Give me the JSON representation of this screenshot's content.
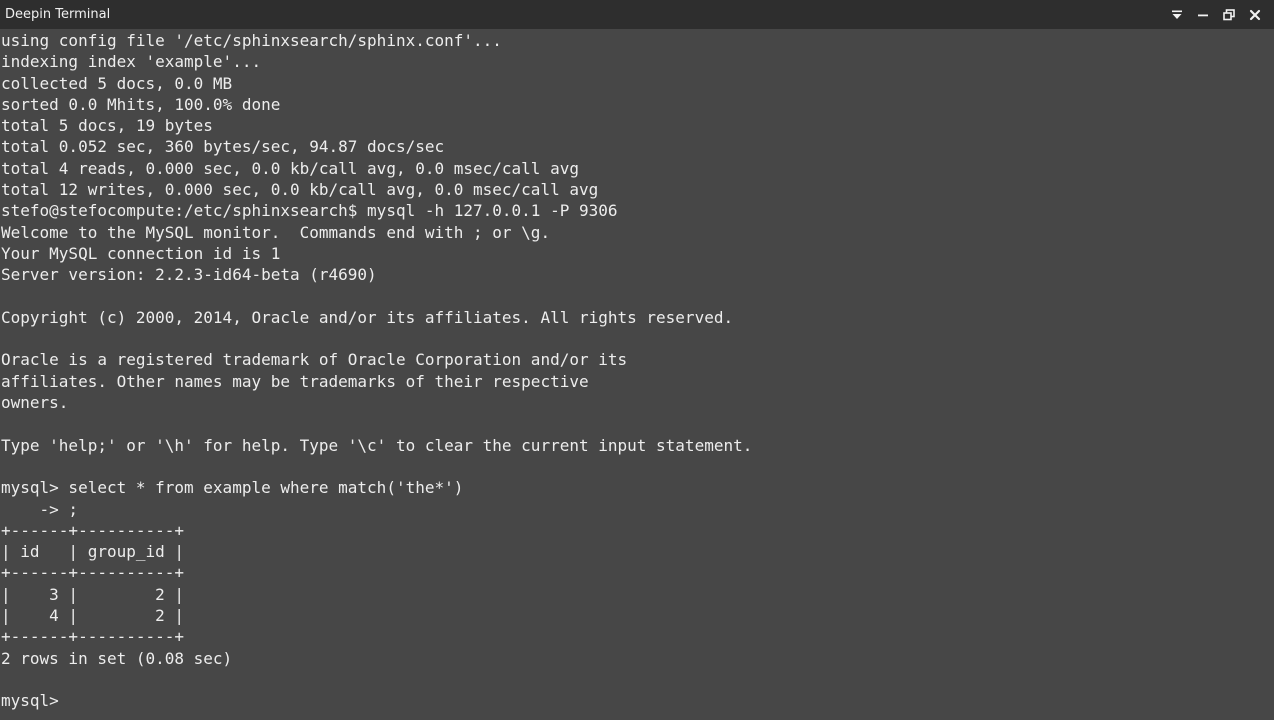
{
  "window": {
    "title": "Deepin Terminal",
    "controls": [
      "menu-icon",
      "minimize-icon",
      "maximize-icon",
      "close-icon"
    ]
  },
  "terminal": {
    "lines": [
      "using config file '/etc/sphinxsearch/sphinx.conf'...",
      "indexing index 'example'...",
      "collected 5 docs, 0.0 MB",
      "sorted 0.0 Mhits, 100.0% done",
      "total 5 docs, 19 bytes",
      "total 0.052 sec, 360 bytes/sec, 94.87 docs/sec",
      "total 4 reads, 0.000 sec, 0.0 kb/call avg, 0.0 msec/call avg",
      "total 12 writes, 0.000 sec, 0.0 kb/call avg, 0.0 msec/call avg",
      "stefo@stefocompute:/etc/sphinxsearch$ mysql -h 127.0.0.1 -P 9306",
      "Welcome to the MySQL monitor.  Commands end with ; or \\g.",
      "Your MySQL connection id is 1",
      "Server version: 2.2.3-id64-beta (r4690)",
      "",
      "Copyright (c) 2000, 2014, Oracle and/or its affiliates. All rights reserved.",
      "",
      "Oracle is a registered trademark of Oracle Corporation and/or its",
      "affiliates. Other names may be trademarks of their respective",
      "owners.",
      "",
      "Type 'help;' or '\\h' for help. Type '\\c' to clear the current input statement.",
      "",
      "mysql> select * from example where match('the*')",
      "    -> ;",
      "+------+----------+",
      "| id   | group_id |",
      "+------+----------+",
      "|    3 |        2 |",
      "|    4 |        2 |",
      "+------+----------+",
      "2 rows in set (0.08 sec)",
      "",
      "mysql> "
    ]
  },
  "colors": {
    "background": "#474747",
    "titlebar": "#2e2e2e",
    "text": "#ededed"
  }
}
